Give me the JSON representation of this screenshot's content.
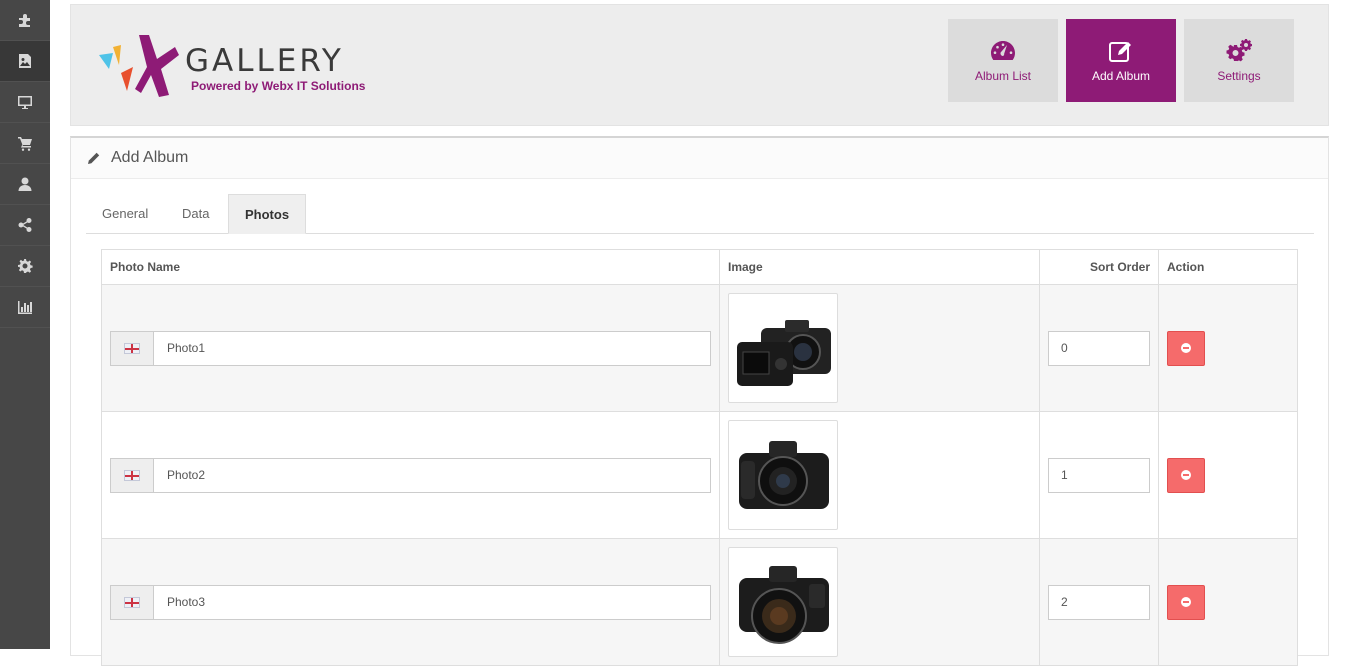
{
  "sidebar": {
    "items": [
      {
        "icon": "puzzle-icon"
      },
      {
        "icon": "image-icon",
        "active": true
      },
      {
        "icon": "monitor-icon"
      },
      {
        "icon": "cart-icon"
      },
      {
        "icon": "user-icon"
      },
      {
        "icon": "share-icon"
      },
      {
        "icon": "gear-icon"
      },
      {
        "icon": "bar-chart-icon"
      }
    ]
  },
  "header": {
    "logo_text": "GALLERY",
    "logo_subtitle": "Powered by Webx IT Solutions",
    "nav": [
      {
        "label": "Album List",
        "icon": "dashboard-icon"
      },
      {
        "label": "Add Album",
        "icon": "edit-icon",
        "active": true
      },
      {
        "label": "Settings",
        "icon": "gears-icon"
      }
    ]
  },
  "panel": {
    "title": "Add Album",
    "tabs": [
      {
        "label": "General"
      },
      {
        "label": "Data"
      },
      {
        "label": "Photos",
        "active": true
      }
    ]
  },
  "table": {
    "headers": {
      "photo_name": "Photo Name",
      "image": "Image",
      "sort_order": "Sort Order",
      "action": "Action"
    },
    "rows": [
      {
        "name": "Photo1",
        "sort_order": "0"
      },
      {
        "name": "Photo2",
        "sort_order": "1"
      },
      {
        "name": "Photo3",
        "sort_order": "2"
      }
    ]
  },
  "colors": {
    "brand": "#8e1b76",
    "sidebar": "#474747",
    "delete": "#f56b6b"
  }
}
